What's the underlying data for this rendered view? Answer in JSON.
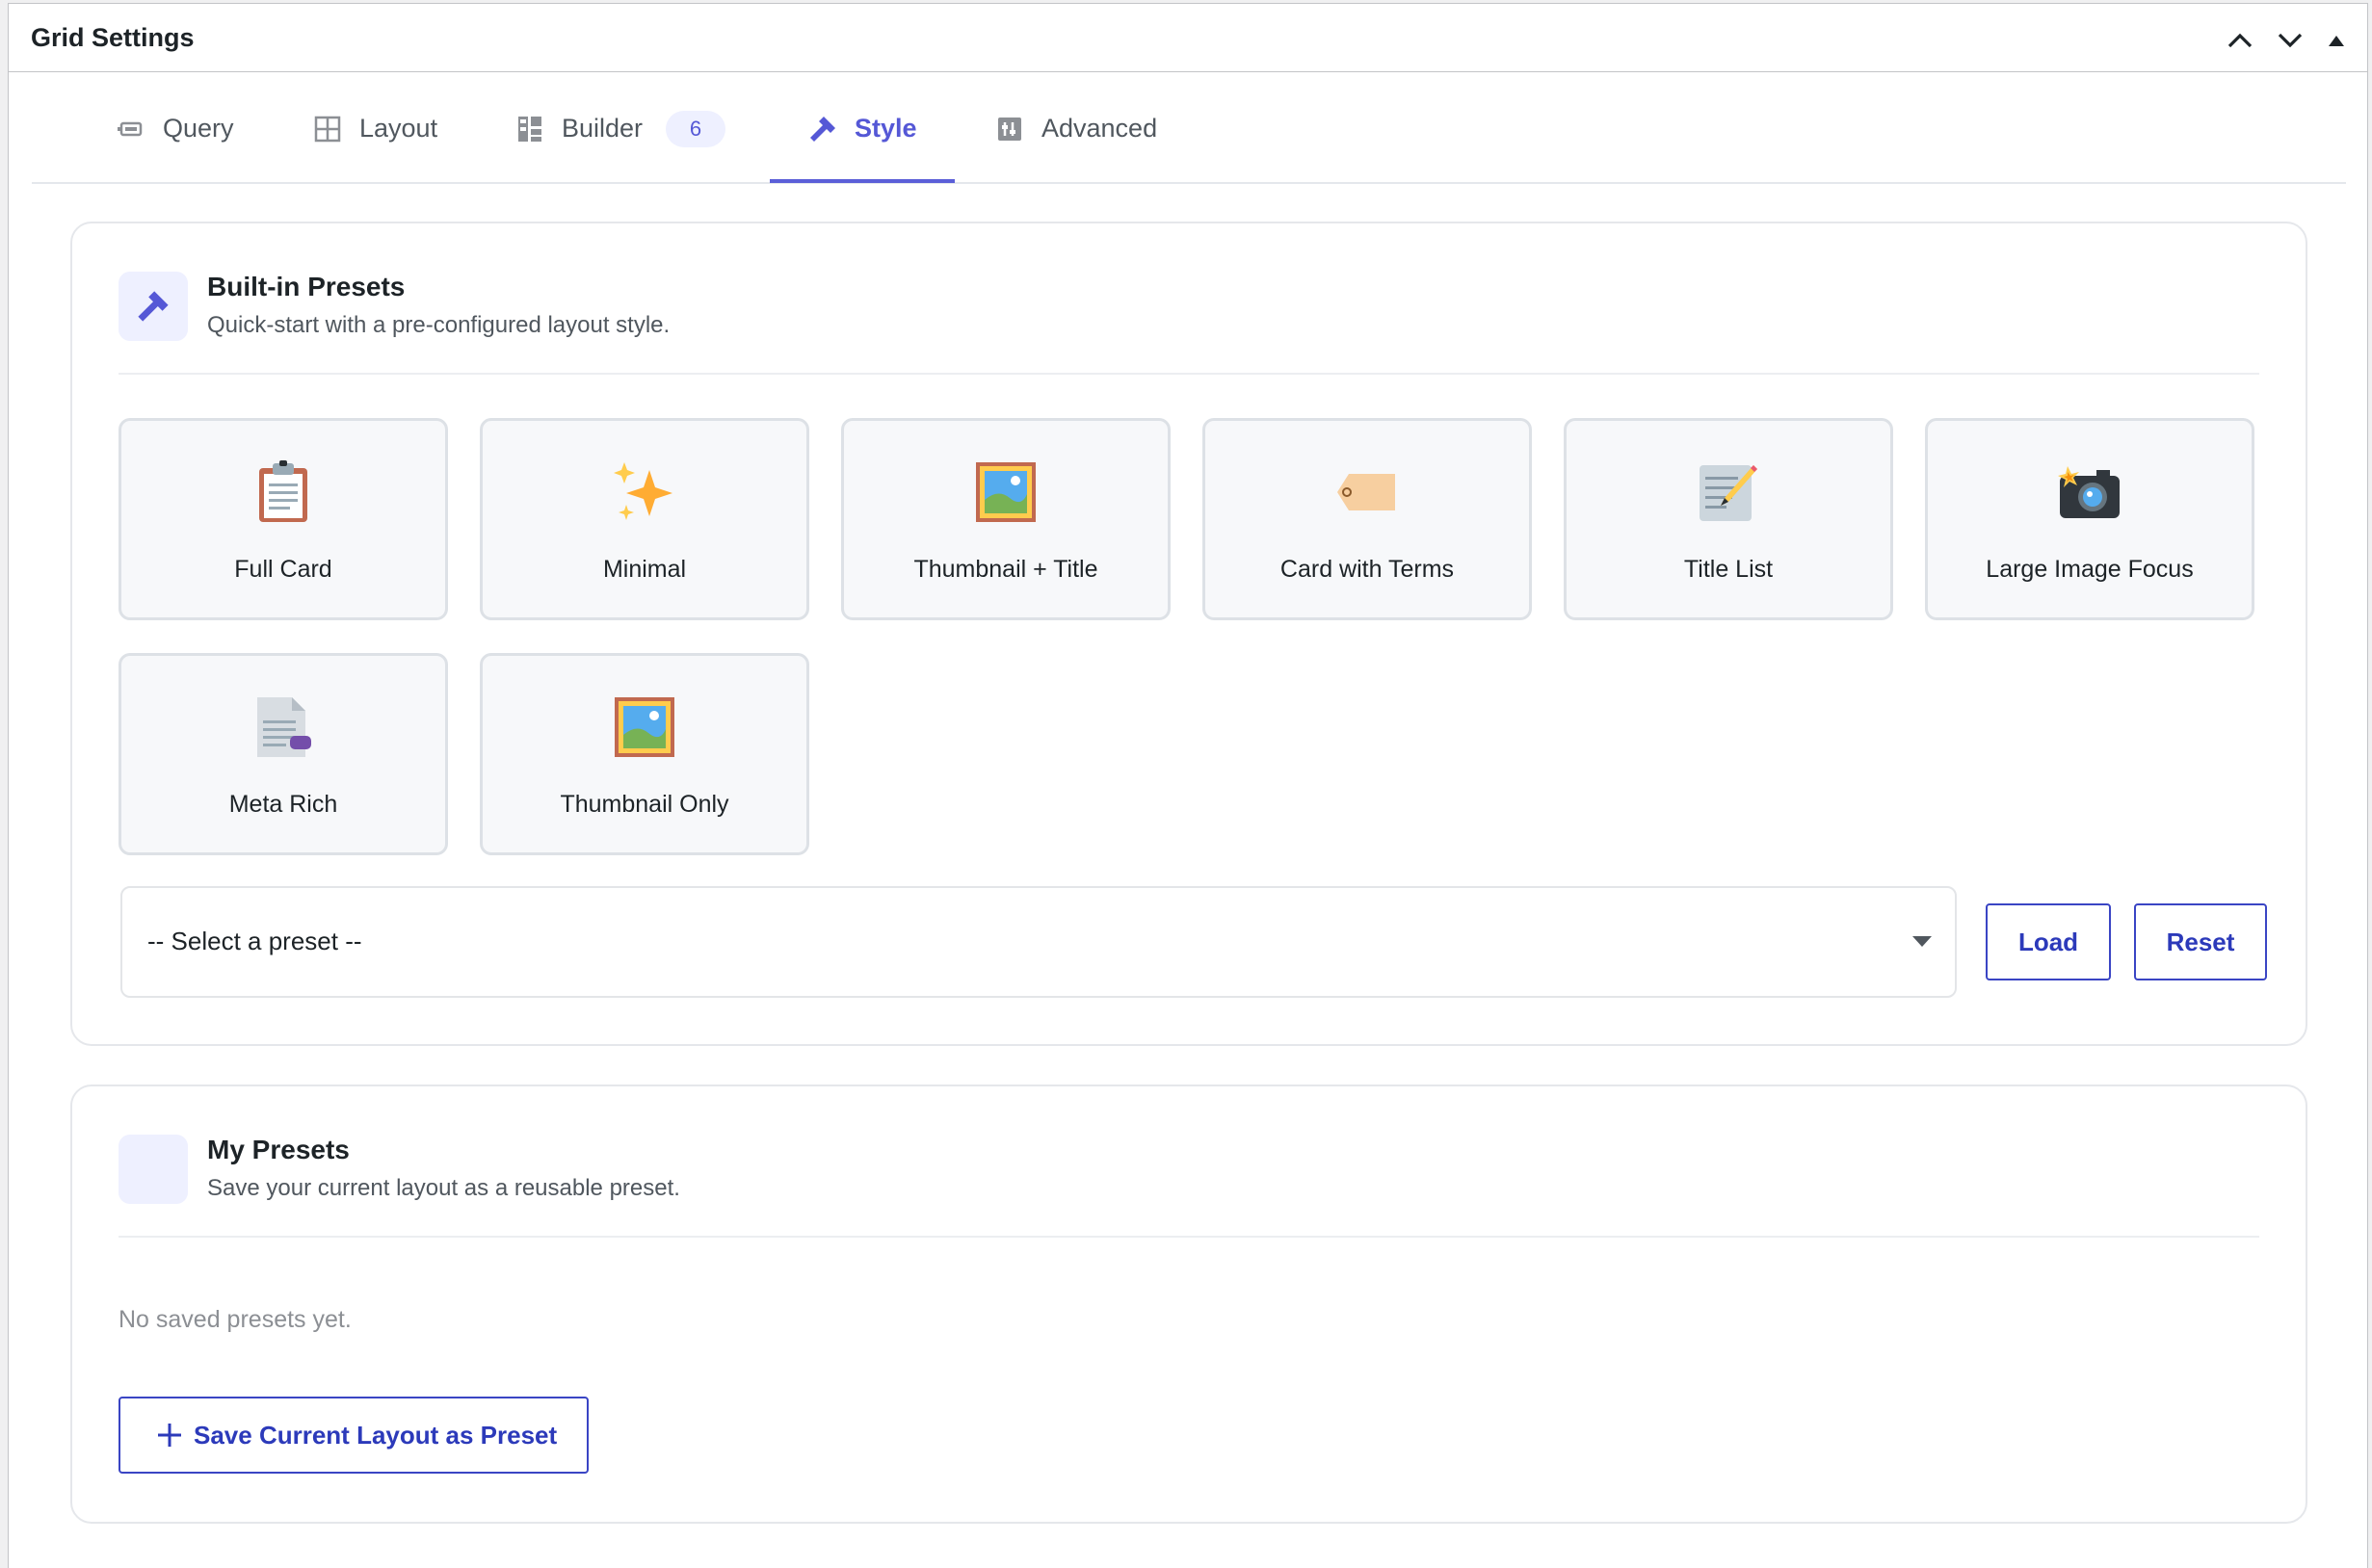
{
  "panel": {
    "title": "Grid Settings",
    "controls": [
      {
        "name": "move-up",
        "icon": "chevron-up-icon"
      },
      {
        "name": "move-down",
        "icon": "chevron-down-icon"
      },
      {
        "name": "toggle-panel",
        "icon": "triangle-up-icon"
      }
    ]
  },
  "tabs": [
    {
      "label": "Query",
      "icon": "query-icon"
    },
    {
      "label": "Layout",
      "icon": "layout-grid-icon"
    },
    {
      "label": "Builder",
      "icon": "builder-icon",
      "badge": "6"
    },
    {
      "label": "Style",
      "icon": "brush-icon",
      "active": true
    },
    {
      "label": "Advanced",
      "icon": "advanced-icon"
    }
  ],
  "builtin": {
    "title": "Built-in Presets",
    "subtitle": "Quick-start with a pre-configured layout style.",
    "presets": [
      {
        "label": "Full Card",
        "icon": "clipboard-icon"
      },
      {
        "label": "Minimal",
        "icon": "sparkles-icon"
      },
      {
        "label": "Thumbnail + Title",
        "icon": "framed-picture-icon"
      },
      {
        "label": "Card with Terms",
        "icon": "tag-icon"
      },
      {
        "label": "Title List",
        "icon": "memo-icon"
      },
      {
        "label": "Large Image Focus",
        "icon": "camera-flash-icon"
      },
      {
        "label": "Meta Rich",
        "icon": "document-icon"
      },
      {
        "label": "Thumbnail Only",
        "icon": "framed-picture-icon"
      }
    ],
    "select": {
      "value": "-- Select a preset --"
    },
    "load_label": "Load",
    "reset_label": "Reset"
  },
  "mypresets": {
    "title": "My Presets",
    "subtitle": "Save your current layout as a reusable preset.",
    "empty_text": "No saved presets yet.",
    "save_label": "Save Current Layout as Preset"
  },
  "colors": {
    "accent": "#5558d6",
    "button_blue": "#2c3aba",
    "icon_bg": "#eef0ff"
  }
}
